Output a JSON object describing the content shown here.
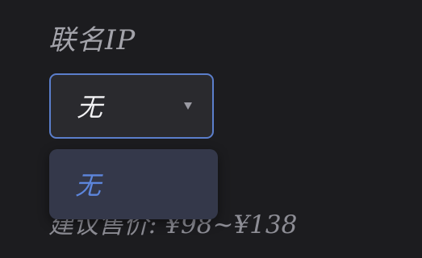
{
  "form": {
    "field_label": "联名IP",
    "select": {
      "selected_value": "无",
      "chevron_icon": "chevron-down-icon"
    },
    "dropdown": {
      "options": [
        {
          "label": "无",
          "selected": true
        }
      ]
    },
    "price_hint": "建议售价: ¥98~¥138"
  },
  "colors": {
    "background": "#1c1c1f",
    "select_border": "#5b7ecb",
    "option_selected_text": "#5d86dc",
    "dropdown_background": "#34384a"
  }
}
